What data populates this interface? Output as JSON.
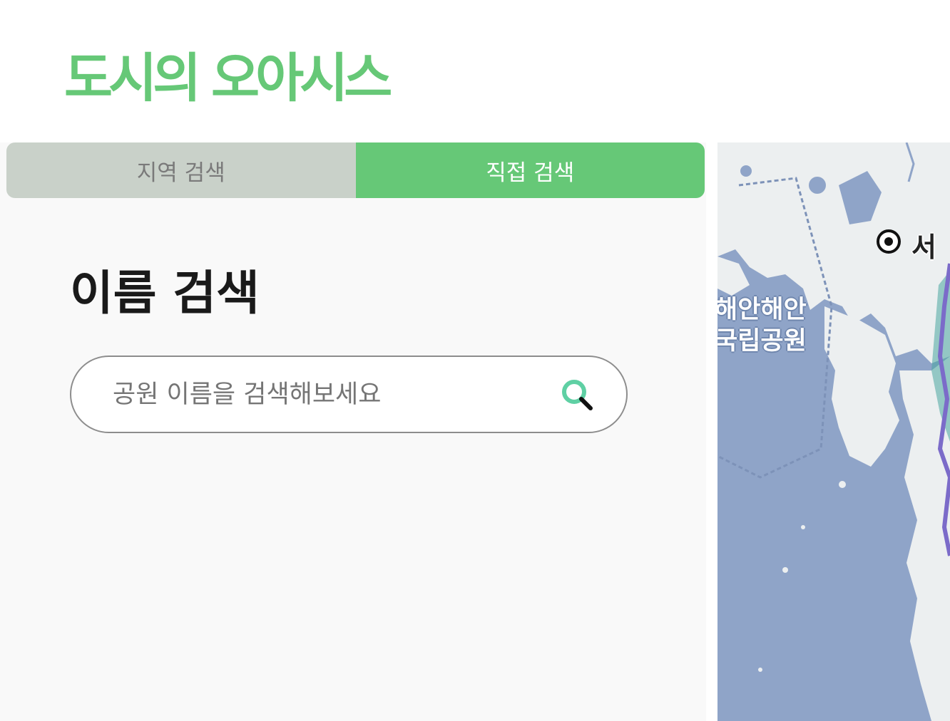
{
  "app": {
    "title": "도시의 오아시스"
  },
  "tabs": [
    {
      "label": "지역 검색",
      "active": false
    },
    {
      "label": "직접 검색",
      "active": true
    }
  ],
  "search": {
    "heading": "이름 검색",
    "placeholder": "공원 이름을 검색해보세요",
    "value": "",
    "icon": "search-icon"
  },
  "map": {
    "labels": {
      "park_line1": "해안해안",
      "park_line2": "국립공원",
      "city": "서"
    },
    "marker_icon": "city-marker-icon"
  },
  "colors": {
    "brand": "#66c877",
    "tab_inactive": "#c9d1c9",
    "map_water": "#8fa4c8",
    "map_land": "#eceff0",
    "route": "#7b6bc9"
  }
}
